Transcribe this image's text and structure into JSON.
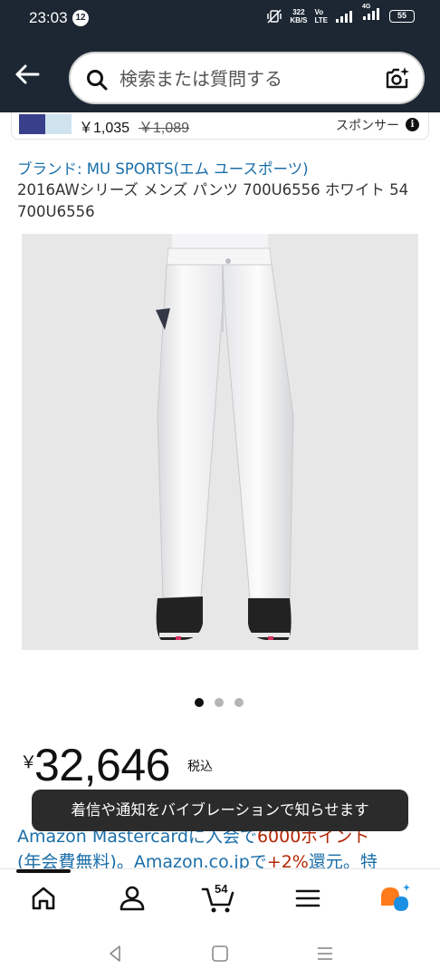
{
  "status_bar": {
    "time": "23:03",
    "notification_count": "12",
    "net_speed_value": "322",
    "net_speed_unit": "KB/S",
    "volte_top": "Vo",
    "volte_bottom": "LTE",
    "network_label": "4G",
    "battery": "55"
  },
  "header": {
    "search_placeholder": "検索または質問する"
  },
  "sponsored": {
    "price": "￥1,035",
    "old_price": "￥1,089",
    "label": "スポンサー"
  },
  "product": {
    "brand_link": "ブランド: MU SPORTS(エム ユースポーツ)",
    "title": "2016AWシリーズ メンズ パンツ 700U6556 ホワイト 54 700U6556",
    "image_count": 3,
    "active_image": 1,
    "currency": "￥",
    "price": "32,646",
    "tax_label": "税込"
  },
  "promo": {
    "line1_a": "Amazon Mastercardに入会で",
    "line1_b": "6000ポイント",
    "line2_a": "(年会費無料)。Amazon.co.jpで",
    "line2_b": "+2%",
    "line2_c": "還元。特"
  },
  "toast": {
    "message": "着信や通知をバイブレーションで知らせます"
  },
  "bottom_nav": {
    "cart_count": "54"
  },
  "colors": {
    "header_bg": "#1c2733",
    "link": "#1a6ea8",
    "promo_red": "#b12704"
  }
}
